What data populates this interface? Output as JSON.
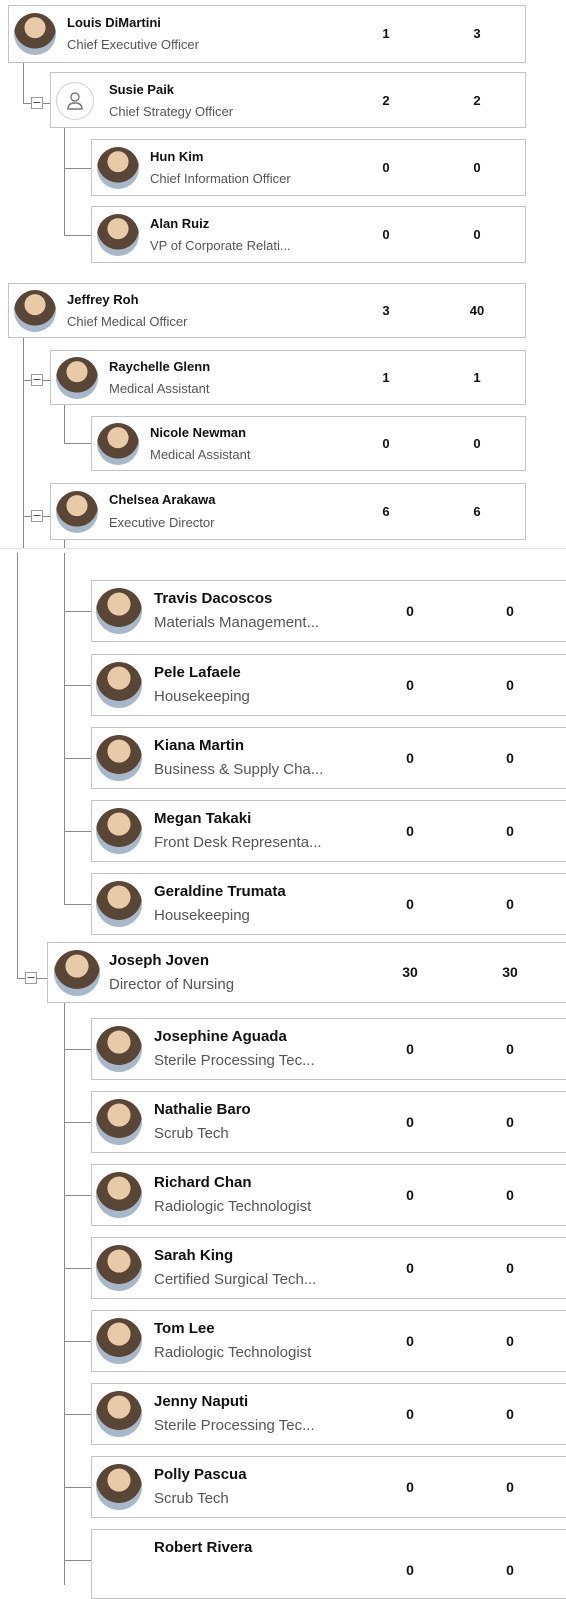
{
  "people": {
    "louis": {
      "name": "Louis DiMartini",
      "title": "Chief Executive Officer",
      "c1": "1",
      "c2": "3"
    },
    "susie": {
      "name": "Susie Paik",
      "title": "Chief Strategy Officer",
      "c1": "2",
      "c2": "2"
    },
    "hun": {
      "name": "Hun Kim",
      "title": "Chief Information Officer",
      "c1": "0",
      "c2": "0"
    },
    "alan": {
      "name": "Alan Ruiz",
      "title": "VP of Corporate Relati...",
      "c1": "0",
      "c2": "0"
    },
    "jeffrey": {
      "name": "Jeffrey Roh",
      "title": "Chief Medical Officer",
      "c1": "3",
      "c2": "40"
    },
    "raychelle": {
      "name": "Raychelle Glenn",
      "title": "Medical Assistant",
      "c1": "1",
      "c2": "1"
    },
    "nicole": {
      "name": "Nicole Newman",
      "title": "Medical Assistant",
      "c1": "0",
      "c2": "0"
    },
    "chelsea": {
      "name": "Chelsea Arakawa",
      "title": "Executive Director",
      "c1": "6",
      "c2": "6"
    },
    "travis": {
      "name": "Travis Dacoscos",
      "title": "Materials Management...",
      "c1": "0",
      "c2": "0"
    },
    "pele": {
      "name": "Pele Lafaele",
      "title": "Housekeeping",
      "c1": "0",
      "c2": "0"
    },
    "kiana": {
      "name": "Kiana Martin",
      "title": "Business & Supply Cha...",
      "c1": "0",
      "c2": "0"
    },
    "megan": {
      "name": "Megan Takaki",
      "title": "Front Desk Representa...",
      "c1": "0",
      "c2": "0"
    },
    "geraldine": {
      "name": "Geraldine Trumata",
      "title": "Housekeeping",
      "c1": "0",
      "c2": "0"
    },
    "joseph": {
      "name": "Joseph Joven",
      "title": "Director of Nursing",
      "c1": "30",
      "c2": "30"
    },
    "josephine": {
      "name": "Josephine Aguada",
      "title": "Sterile Processing Tec...",
      "c1": "0",
      "c2": "0"
    },
    "nathalie": {
      "name": "Nathalie Baro",
      "title": "Scrub Tech",
      "c1": "0",
      "c2": "0"
    },
    "richard": {
      "name": "Richard Chan",
      "title": "Radiologic Technologist",
      "c1": "0",
      "c2": "0"
    },
    "sarah": {
      "name": "Sarah King",
      "title": "Certified Surgical Tech...",
      "c1": "0",
      "c2": "0"
    },
    "tom": {
      "name": "Tom Lee",
      "title": "Radiologic Technologist",
      "c1": "0",
      "c2": "0"
    },
    "jenny": {
      "name": "Jenny Naputi",
      "title": "Sterile Processing Tec...",
      "c1": "0",
      "c2": "0"
    },
    "polly": {
      "name": "Polly Pascua",
      "title": "Scrub Tech",
      "c1": "0",
      "c2": "0"
    },
    "robert": {
      "name": "Robert Rivera",
      "title": "",
      "c1": "0",
      "c2": "0"
    }
  },
  "toggle_symbol": "−",
  "icons": {
    "collapse": "minus-toggle-icon",
    "placeholder_avatar": "person-outline-icon"
  },
  "colors": {
    "border": "#c4c4c4",
    "connector": "#8a8a8a",
    "title_text": "#555555"
  }
}
